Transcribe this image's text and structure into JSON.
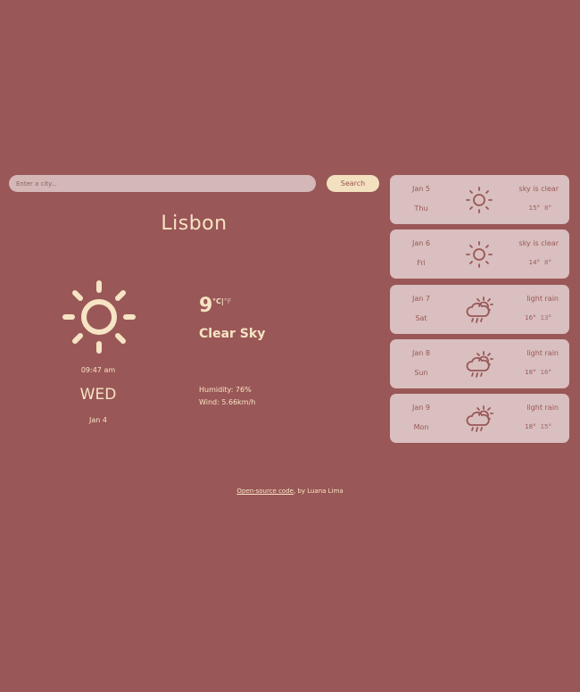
{
  "search": {
    "placeholder": "Enter a city...",
    "button_label": "Search"
  },
  "current": {
    "city": "Lisbon",
    "icon": "sun-icon",
    "time": "09:47 am",
    "day": "WED",
    "date": "Jan 4",
    "temperature": "9",
    "unit_c": "°C",
    "unit_sep": "|",
    "unit_f": "°F",
    "description": "Clear Sky",
    "humidity": "Humidity: 76%",
    "wind": "Wind: 5.66km/h"
  },
  "forecast": [
    {
      "date": "Jan 5",
      "day": "Thu",
      "icon": "sun-icon",
      "description": "sky is clear",
      "max": "15°",
      "min": "8°"
    },
    {
      "date": "Jan 6",
      "day": "Fri",
      "icon": "sun-icon",
      "description": "sky is clear",
      "max": "14°",
      "min": "8°"
    },
    {
      "date": "Jan 7",
      "day": "Sat",
      "icon": "sun-rain-icon",
      "description": "light rain",
      "max": "16°",
      "min": "13°"
    },
    {
      "date": "Jan 8",
      "day": "Sun",
      "icon": "sun-rain-icon",
      "description": "light rain",
      "max": "18°",
      "min": "16°"
    },
    {
      "date": "Jan 9",
      "day": "Mon",
      "icon": "sun-rain-icon",
      "description": "light rain",
      "max": "18°",
      "min": "15°"
    }
  ],
  "footer": {
    "link_text": "Open-source code",
    "suffix": ", by Luana Lima"
  },
  "colors": {
    "background": "#9a5757",
    "card": "#d9bfbf",
    "accent": "#f6e4c4"
  }
}
